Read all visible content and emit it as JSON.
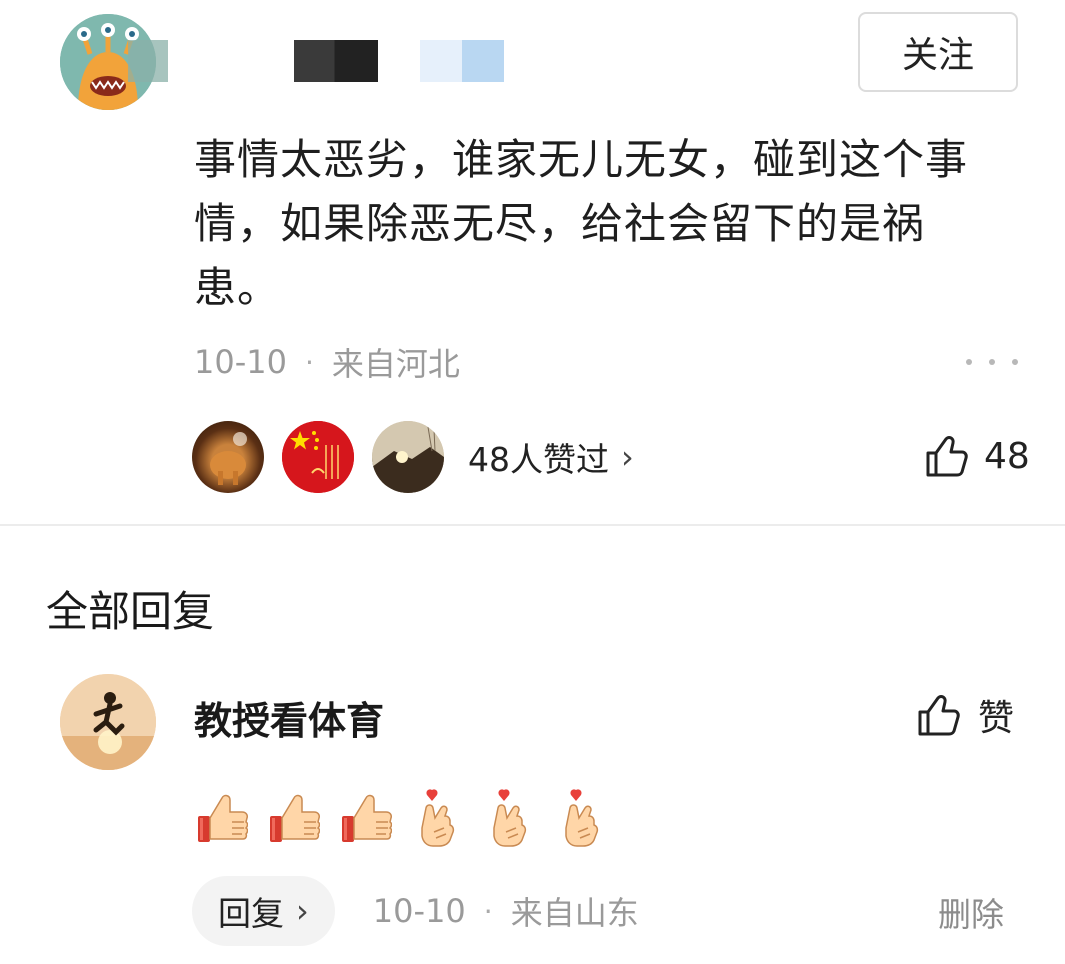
{
  "comment": {
    "follow_label": "关注",
    "text": "事情太恶劣，谁家无儿无女，碰到这个事情，如果除恶无尽，给社会留下的是祸患。",
    "date": "10-10",
    "separator": "·",
    "location": "来自河北",
    "likers_text": "48人赞过",
    "like_count": "48"
  },
  "replies_title": "全部回复",
  "reply": {
    "author": "教授看体育",
    "like_label": "赞",
    "emoji": [
      "thumbs-up-emoji",
      "thumbs-up-emoji",
      "thumbs-up-emoji",
      "finger-heart-emoji",
      "finger-heart-emoji",
      "finger-heart-emoji"
    ],
    "reply_label": "回复",
    "date": "10-10",
    "separator": "·",
    "location": "来自山东",
    "delete_label": "删除"
  },
  "colors": {
    "text": "#1a1a1a",
    "muted": "#9a9a9a",
    "divider": "#ececec",
    "button_bg": "#f3f3f3"
  }
}
